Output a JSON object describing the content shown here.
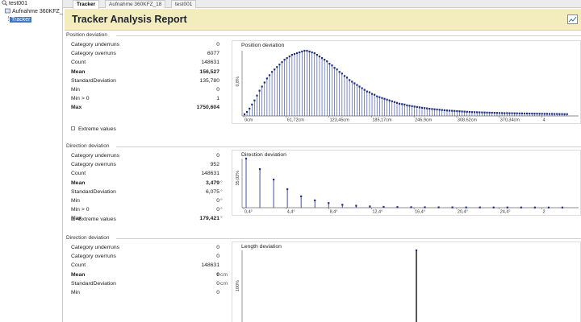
{
  "tree": {
    "root_label": "test001",
    "child_label": "Aufnahme 360KFZ_",
    "selected_label": "Tracker"
  },
  "tabs": [
    "Tracker",
    "Aufnahme 360KFZ_18",
    "test001"
  ],
  "header": {
    "title": "Tracker Analysis Report"
  },
  "sections": [
    {
      "title": "Position deviation",
      "stats": [
        {
          "label": "Category underruns",
          "value": "0",
          "unit": ""
        },
        {
          "label": "Category overruns",
          "value": "6077",
          "unit": ""
        },
        {
          "label": "Count",
          "value": "148631",
          "unit": ""
        },
        {
          "label": "Mean",
          "value": "156,527",
          "unit": ""
        },
        {
          "label": "StandardDeviation",
          "value": "135,780",
          "unit": ""
        },
        {
          "label": "Min",
          "value": "0",
          "unit": ""
        },
        {
          "label": "Min > 0",
          "value": "1",
          "unit": ""
        },
        {
          "label": "Max",
          "value": "1750,604",
          "unit": ""
        }
      ],
      "extreme_label": "Extreme values",
      "chart_title": "Position deviation",
      "y_label": "0,8%",
      "x_ticks": [
        "0cm",
        "61,72cm",
        "123,45cm",
        "185,17cm",
        "246,9cm",
        "308,62cm",
        "370,34cm",
        "4"
      ]
    },
    {
      "title": "Direction deviation",
      "stats": [
        {
          "label": "Category underruns",
          "value": "0",
          "unit": ""
        },
        {
          "label": "Category overruns",
          "value": "952",
          "unit": ""
        },
        {
          "label": "Count",
          "value": "148631",
          "unit": ""
        },
        {
          "label": "Mean",
          "value": "3,479",
          "unit": "°"
        },
        {
          "label": "StandardDeviation",
          "value": "6,075",
          "unit": "°"
        },
        {
          "label": "Min",
          "value": "0",
          "unit": "°"
        },
        {
          "label": "Min > 0",
          "value": "0",
          "unit": "°"
        },
        {
          "label": "Max",
          "value": "179,421",
          "unit": "°"
        }
      ],
      "extreme_label": "Extreme values",
      "chart_title": "Direction deviation",
      "y_label": "35,02%",
      "x_ticks": [
        "0,4°",
        "4,4°",
        "8,4°",
        "12,4°",
        "16,4°",
        "20,4°",
        "24,4°",
        "2"
      ]
    },
    {
      "title": "Direction deviation",
      "stats": [
        {
          "label": "Category underruns",
          "value": "0",
          "unit": ""
        },
        {
          "label": "Category overruns",
          "value": "0",
          "unit": ""
        },
        {
          "label": "Count",
          "value": "148631",
          "unit": ""
        },
        {
          "label": "Mean",
          "value": "0",
          "unit": "cm"
        },
        {
          "label": "StandardDeviation",
          "value": "0",
          "unit": "cm"
        },
        {
          "label": "Min",
          "value": "0",
          "unit": ""
        }
      ],
      "chart_title": "Length deviation",
      "y_label": "100%"
    }
  ],
  "chart_data": [
    {
      "type": "bar",
      "title": "Position deviation",
      "ylabel": "0,8%",
      "xlabel": "",
      "x_tick_labels": [
        "0cm",
        "61,72cm",
        "123,45cm",
        "185,17cm",
        "246,9cm",
        "308,62cm",
        "370,34cm"
      ],
      "series": [
        {
          "values": [
            0.02,
            0.05,
            0.09,
            0.14,
            0.19,
            0.25,
            0.31,
            0.36,
            0.41,
            0.46,
            0.5,
            0.54,
            0.57,
            0.6,
            0.63,
            0.66,
            0.69,
            0.71,
            0.73,
            0.75,
            0.76,
            0.77,
            0.78,
            0.79,
            0.8,
            0.8,
            0.79,
            0.78,
            0.77,
            0.75,
            0.73,
            0.71,
            0.69,
            0.67,
            0.64,
            0.62,
            0.59,
            0.57,
            0.54,
            0.52,
            0.49,
            0.47,
            0.44,
            0.42,
            0.4,
            0.38,
            0.36,
            0.34,
            0.32,
            0.3,
            0.29,
            0.27,
            0.26,
            0.24,
            0.23,
            0.22,
            0.21,
            0.2,
            0.19,
            0.18,
            0.17,
            0.16,
            0.15,
            0.145,
            0.14,
            0.13,
            0.125,
            0.12,
            0.115,
            0.11,
            0.105,
            0.1,
            0.096,
            0.092,
            0.088,
            0.085,
            0.082,
            0.079,
            0.076,
            0.073,
            0.07,
            0.067,
            0.065,
            0.063,
            0.061,
            0.059,
            0.057,
            0.055,
            0.053,
            0.051,
            0.049,
            0.047,
            0.046,
            0.045,
            0.044,
            0.043,
            0.042,
            0.041,
            0.04,
            0.039,
            0.038,
            0.037,
            0.036,
            0.035,
            0.034,
            0.034,
            0.033,
            0.033,
            0.032,
            0.032,
            0.031,
            0.031,
            0.03,
            0.03,
            0.029,
            0.029,
            0.028,
            0.028,
            0.027,
            0.027,
            0.026,
            0.026,
            0.025,
            0.025,
            0.024,
            0.024,
            0.023,
            0.023,
            0.022,
            0.022
          ]
        }
      ]
    },
    {
      "type": "bar",
      "title": "Direction deviation",
      "ylabel": "35,02%",
      "xlabel": "",
      "x_tick_labels": [
        "0,4°",
        "4,4°",
        "8,4°",
        "12,4°",
        "16,4°",
        "20,4°",
        "24,4°"
      ],
      "series": [
        {
          "values": [
            35.02,
            0,
            0,
            27.5,
            0,
            0,
            20.1,
            0,
            0,
            13.2,
            0,
            0,
            8.1,
            0,
            0,
            5.2,
            0,
            0,
            3.3,
            0,
            0,
            2.1,
            0,
            0,
            1.4,
            0,
            0,
            0.9,
            0,
            0,
            0.6,
            0,
            0,
            0.45,
            0,
            0,
            0.35,
            0,
            0,
            0.3,
            0,
            0,
            0.25,
            0,
            0,
            0.22,
            0,
            0,
            0.2,
            0,
            0,
            0.18,
            0,
            0,
            0.16,
            0,
            0,
            0.15,
            0,
            0,
            0.14,
            0,
            0,
            0.13,
            0,
            0,
            0.12,
            0,
            0,
            0.12
          ]
        }
      ]
    },
    {
      "type": "bar",
      "title": "Length deviation",
      "ylabel": "100%",
      "xlabel": "",
      "series": [
        {
          "values": [
            100
          ]
        }
      ]
    }
  ]
}
